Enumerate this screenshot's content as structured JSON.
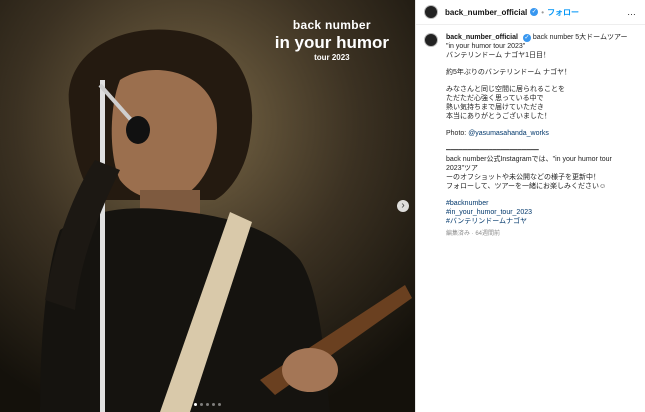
{
  "overlay": {
    "line1": "back number",
    "line2": "in your humor",
    "line3": "tour 2023"
  },
  "header": {
    "username": "back_number_official",
    "separator": "•",
    "follow_label": "フォロー",
    "more_icon": "…"
  },
  "caption": {
    "username": "back_number_official",
    "first_line": "back number 5大ドームツアー",
    "line2": "\"in your humor tour 2023\"",
    "line3": "バンテリンドーム ナゴヤ1日目！",
    "line4": "約5年ぶりのバンテリンドーム ナゴヤ！",
    "line5": "みなさんと同じ空間に居られることを",
    "line6": "ただただ心強く思っている中で",
    "line7": "熱い気持ちまで届けていただき",
    "line8": "本当にありがとうございました！",
    "photo_label": "Photo: ",
    "photo_handle": "@yasumasahanda_works",
    "divider": "━━━━━━━━━━━━━━━━━━━━━━",
    "line9": "back number公式Instagramでは、\"in your humor tour 2023\"ツア",
    "line10": "ーのオフショットや未公開などの様子を更新中！",
    "line11": "フォローして、ツアーを一緒にお楽しみください☺",
    "tag1": "#backnumber",
    "tag2": "#in_your_humor_tour_2023",
    "tag3": "#バンテリンドームナゴヤ",
    "meta": "編集済み · 64週間前"
  },
  "carousel": {
    "next_icon": "›",
    "count": 5,
    "active": 0
  },
  "colors": {
    "accent": "#0095f6",
    "verified": "#3897f0",
    "link": "#00376b"
  }
}
